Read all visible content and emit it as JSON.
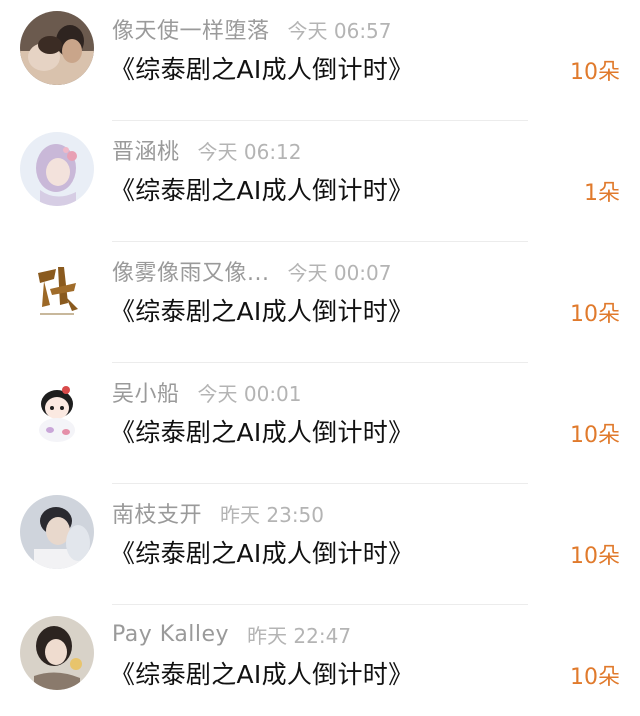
{
  "colors": {
    "name": "#9a9a9a",
    "time": "#b4b4b4",
    "title": "#111111",
    "count": "#e07a2c",
    "divider": "#ececec"
  },
  "items": [
    {
      "avatar": "user-avatar-photo",
      "name": "像天使一样堕落",
      "time": "今天 06:57",
      "title": "《综泰剧之AI成人倒计时》",
      "count": "10朵"
    },
    {
      "avatar": "user-avatar-illustration",
      "name": "晋涵桃",
      "time": "今天 06:12",
      "title": "《综泰剧之AI成人倒计时》",
      "count": "1朵"
    },
    {
      "avatar": "user-avatar-calligraphy",
      "name": "像雾像雨又像...",
      "time": "今天 00:07",
      "title": "《综泰剧之AI成人倒计时》",
      "count": "10朵"
    },
    {
      "avatar": "user-avatar-cartoon",
      "name": "吴小船",
      "time": "今天 00:01",
      "title": "《综泰剧之AI成人倒计时》",
      "count": "10朵"
    },
    {
      "avatar": "user-avatar-photo",
      "name": "南枝支开",
      "time": "昨天 23:50",
      "title": "《综泰剧之AI成人倒计时》",
      "count": "10朵"
    },
    {
      "avatar": "user-avatar-photo",
      "name": "Pay Kalley",
      "time": "昨天 22:47",
      "title": "《综泰剧之AI成人倒计时》",
      "count": "10朵"
    }
  ]
}
